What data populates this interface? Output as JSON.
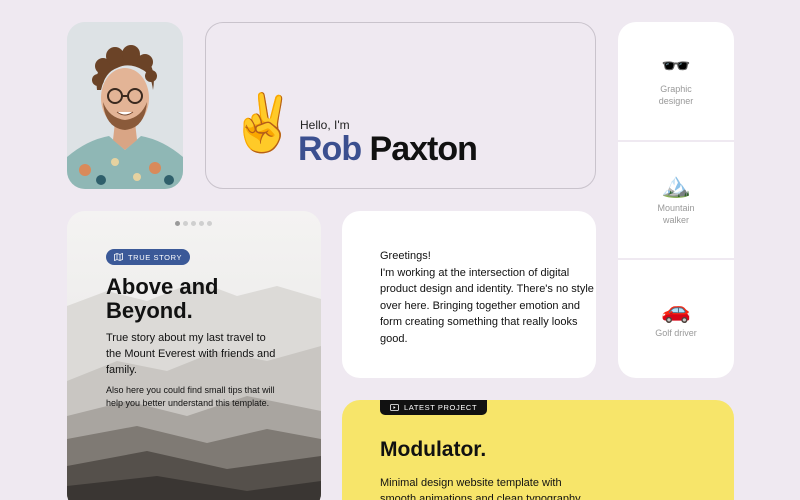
{
  "hello": {
    "greeting": "Hello, I'm",
    "first_name": "Rob",
    "last_name": "Paxton",
    "hand_emoji": "✌️"
  },
  "roles": [
    {
      "icon": "sunglasses-icon",
      "emoji": "🕶️",
      "label": "Graphic designer"
    },
    {
      "icon": "mountain-icon",
      "emoji": "🏔️",
      "label": "Mountain walker"
    },
    {
      "icon": "car-icon",
      "emoji": "🚗",
      "label": "Golf driver"
    }
  ],
  "story": {
    "badge": "TRUE STORY",
    "title": "Above and Beyond.",
    "text": "True story about my last travel to the Mount Everest with friends and family.",
    "note": "Also here you could find small tips that will help you better understand this template.",
    "carousel_pages": 5,
    "carousel_active": 1,
    "badge_color": "#3b5998"
  },
  "greeting": {
    "line1": "Greetings!",
    "body": "I'm working at the intersection of digital product design and identity. There's no style over here. Bringing together emotion and form creating something that really looks good."
  },
  "project": {
    "badge": "LATEST PROJECT",
    "title": "Modulator.",
    "text": "Minimal design website template with smooth animations and clean typography.",
    "background": "#f7e56a"
  },
  "colors": {
    "page_bg": "#efe9f1",
    "name_accent": "#3b4f8f"
  }
}
